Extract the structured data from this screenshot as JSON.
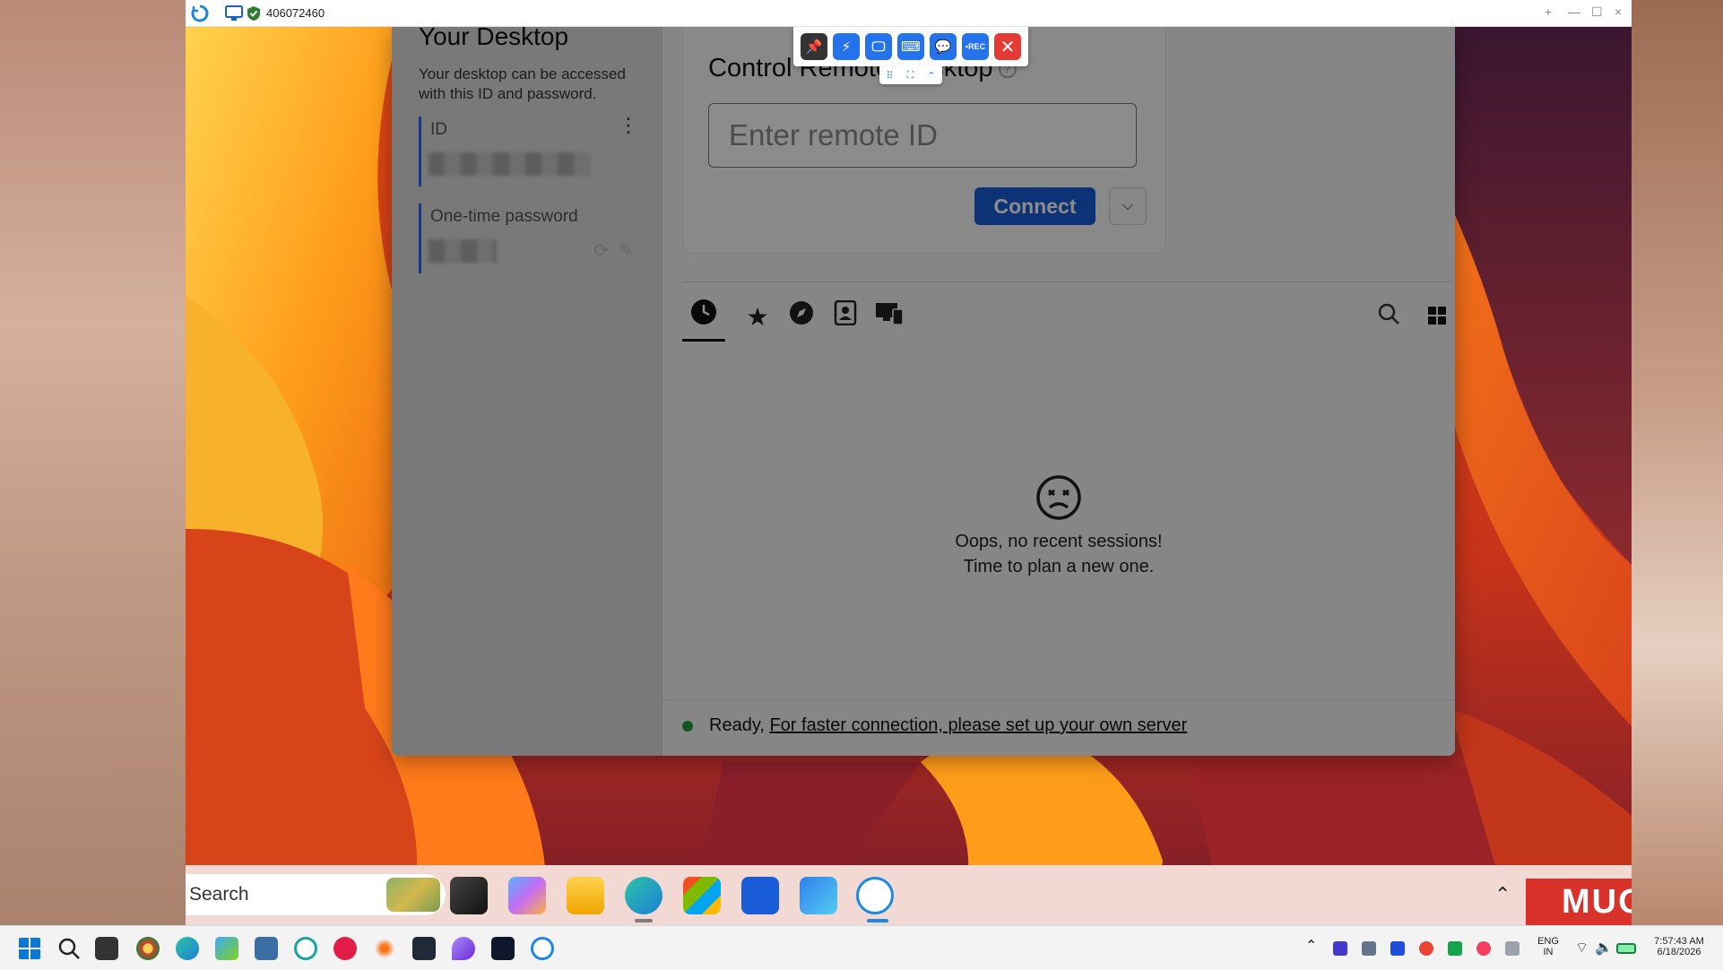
{
  "window": {
    "session_id": "406072460",
    "controls": {
      "new_tab": "+",
      "minimize": "—",
      "maximize": "☐",
      "close": "×"
    }
  },
  "session_toolbar": {
    "buttons": [
      {
        "name": "pin",
        "glyph": "📌"
      },
      {
        "name": "action",
        "glyph": "⚡"
      },
      {
        "name": "display",
        "glyph": "🖵"
      },
      {
        "name": "keyboard",
        "glyph": "⌨"
      },
      {
        "name": "chat",
        "glyph": "💬"
      },
      {
        "name": "record",
        "glyph": "•REC"
      },
      {
        "name": "close",
        "glyph": "✕"
      }
    ]
  },
  "app": {
    "your_desktop": {
      "title": "Your Desktop",
      "description": "Your desktop can be accessed with this ID and password.",
      "id_label": "ID",
      "password_label": "One-time password"
    },
    "control": {
      "title": "Control Remote Desktop",
      "input_placeholder": "Enter remote ID",
      "connect_label": "Connect"
    },
    "tabs": [
      "recent",
      "favorites",
      "discovered",
      "address-book",
      "accessible-devices"
    ],
    "empty": {
      "line1": "Oops, no recent sessions!",
      "line2": "Time to plan a new one."
    },
    "status": {
      "ready": "Ready,",
      "link": "For faster connection, please set up your own server"
    }
  },
  "remote_taskbar": {
    "search_label": "Search",
    "logo": "MUO"
  },
  "host_taskbar": {
    "lang_line1": "ENG",
    "lang_line2": "IN",
    "time": "7:57:43 AM",
    "date": "6/18/2026"
  },
  "colors": {
    "accent": "#1a5bd8",
    "status_ok": "#1f9b3d",
    "toolbar_blue": "#2573ec",
    "close_red": "#e53935"
  }
}
